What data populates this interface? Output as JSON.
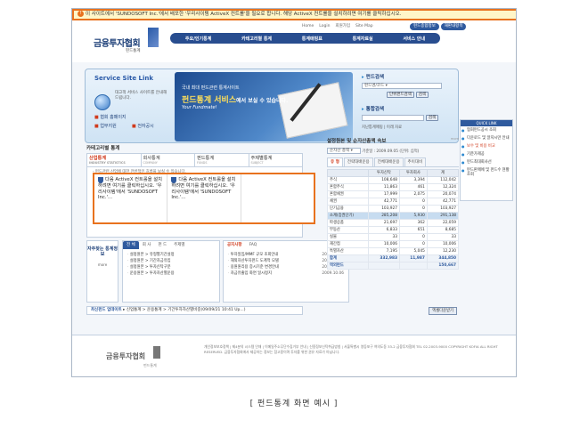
{
  "activex_bar": "이 사이트에서 'SUNDOSOFT Inc.'에서 배포한 '우리사이템 ActiveX 컨트롤'을 필요로 합니다. 해당 ActiveX 컨트롤을 설치하려면 여기를 클릭하십시오.",
  "header": {
    "logo": "금융투자협회",
    "logo_sub": "펀드통계",
    "util_links": [
      "Home",
      "Login",
      "회원가입",
      "Site Map"
    ],
    "util_pills": [
      "펀드종합정보",
      "재판내항목"
    ],
    "gnb": [
      "주요/인기통계",
      "카테고리별 통계",
      "통계매핑표",
      "통계자료실",
      "서비스 안내"
    ]
  },
  "hero": {
    "title": "Service Site Link",
    "desc": "대고객 서비스 사이트를 안내해 드립니다.",
    "links": [
      "협회 홈페이지",
      "업무지원",
      "전자공시"
    ],
    "banner": {
      "line1": "국내 최대 펀드관련 통계사이트",
      "line2": "펀드통계 서비스",
      "line2b": "에서 보실 수 있습니다.",
      "line3": "Your Fundmate!"
    },
    "fund_search_title": "펀드검색",
    "fund_code_placeholder": "펀드명/코드",
    "fund_search_btn": "단위펀드검색",
    "fund_search_btn2": "검색",
    "total_search_title": "통합검색",
    "total_search_btn": "검색",
    "total_search_links": "지난통계매핑 | 이래 자료"
  },
  "quick_link": {
    "title": "QUICK LINK",
    "items": [
      "협회펀드공시 조회",
      "다운로드 및 알지시만 안내",
      "보수 및 비용 비교",
      "기준가제공",
      "펀드최대회사선",
      "펀드판매에 및 펀드수 현황조회"
    ]
  },
  "category": {
    "title": "카테고리별 통계",
    "tabs": [
      {
        "label": "산업통계",
        "sub": "INDUSTRY STATISTICS",
        "active": true
      },
      {
        "label": "회사통계",
        "sub": "COMPANY",
        "active": false
      },
      {
        "label": "펀드통계",
        "sub": "FUNDS",
        "active": false
      },
      {
        "label": "주제별통계",
        "sub": "SUBJECT",
        "active": false
      }
    ],
    "desc": "- 펀드관련 산업에 대한 전반적인 흐름을 보실 수 있습니다.",
    "activex_cells": [
      "다음 ActiveX 컨트롤을 설치하려면 여기를 클릭하십시오. '우리사이템'에서 'SUNDOSOFT Inc.'...",
      "다음 ActiveX 컨트롤을 설치하려면 여기를 클릭하십시오. '우리사이템'에서 'SUNDOSOFT Inc.'..."
    ]
  },
  "faq_tile": {
    "title": "자주찾는 통계정보",
    "more": "more"
  },
  "left_tabs": {
    "tabs": [
      "전 체",
      "회 사",
      "펀 드",
      "주제별"
    ],
    "items": [
      "설정원본 > 유형별기간설정",
      "설정원본 > 기간자금유입",
      "설정원본 > 투자신탁구분",
      "운용원본 > 투자자산별운용"
    ]
  },
  "right_tabs": {
    "tabs": [
      "공지사항",
      "FAQ"
    ],
    "more": "more",
    "items": [
      {
        "text": "투자일임/MMF 규모 조회안내",
        "date": "2009.02.16"
      },
      {
        "text": "해외자산투자펀드 도계적 모델",
        "date": "2009.02.16"
      },
      {
        "text": "웅원원리용 증시기준 변경안내",
        "date": "2009.02.11"
      },
      {
        "text": "자금유출입 화면 일시정지",
        "date": "2009.10.06"
      }
    ]
  },
  "fund_update": {
    "label": "최신펀드 업데이트",
    "text": "신업통계 > 운용통계 > 기간투자자산별비중(09/09/21 10:41 Up...)"
  },
  "table": {
    "title": "설정원본 및 순자산총액 속보",
    "more": "more",
    "filter_label": "순자산 총액",
    "filter_date": "기준일 : 2009.09.05 (단위: 십억)",
    "tabs": [
      "유 형",
      "전략대배운용",
      "전체대배운용",
      "추이대비"
    ],
    "headers": [
      "",
      "투자신탁",
      "투자회사",
      "계"
    ],
    "rows": [
      [
        "주식",
        "108,648",
        "3,394",
        "112,042"
      ],
      [
        "혼합주식",
        "11,863",
        "461",
        "12,324"
      ],
      [
        "혼합채권",
        "17,999",
        "2,075",
        "20,074"
      ],
      [
        "채권",
        "42,771",
        "0",
        "42,771"
      ],
      [
        "단기금융",
        "103,927",
        "0",
        "103,927"
      ],
      [
        "소계(증권단기)",
        "285,208",
        "5,930",
        "291,138"
      ],
      [
        "파생상품",
        "21,697",
        "362",
        "22,059"
      ],
      [
        "부동산",
        "6,833",
        "651",
        "8,685"
      ],
      [
        "실물",
        "33",
        "0",
        "33"
      ],
      [
        "재간접",
        "10,006",
        "0",
        "10,006"
      ],
      [
        "특별자산",
        "7,195",
        "5,045",
        "12,230"
      ],
      [
        "합계",
        "332,983",
        "11,987",
        "344,850"
      ],
      [
        "역외펀드",
        "",
        "",
        "150,667"
      ]
    ],
    "highlight_row": 5,
    "excel_btn": "엑셀다운받기"
  },
  "footer": {
    "logo": "금융투자협회",
    "logo_sub": "펀드통계",
    "text": "개인정보보호정책 | 제4분의 시스템 인재 | 이메일주소무단수집거부 안내 | 신용정보신탁취급방침 | 서울특별시 영등포구 여의도동 33-2 금융투자협회 TEL 02-2003-9000 COPYRIGHT KOFIA ALL RIGHT RESERVED. 금융투자협회에서 제공하는 정보는 참고용이며 투자를 위한 권유 자료가 아닙니다."
  },
  "caption": "[ 펀드통계 화면 예시 ]"
}
